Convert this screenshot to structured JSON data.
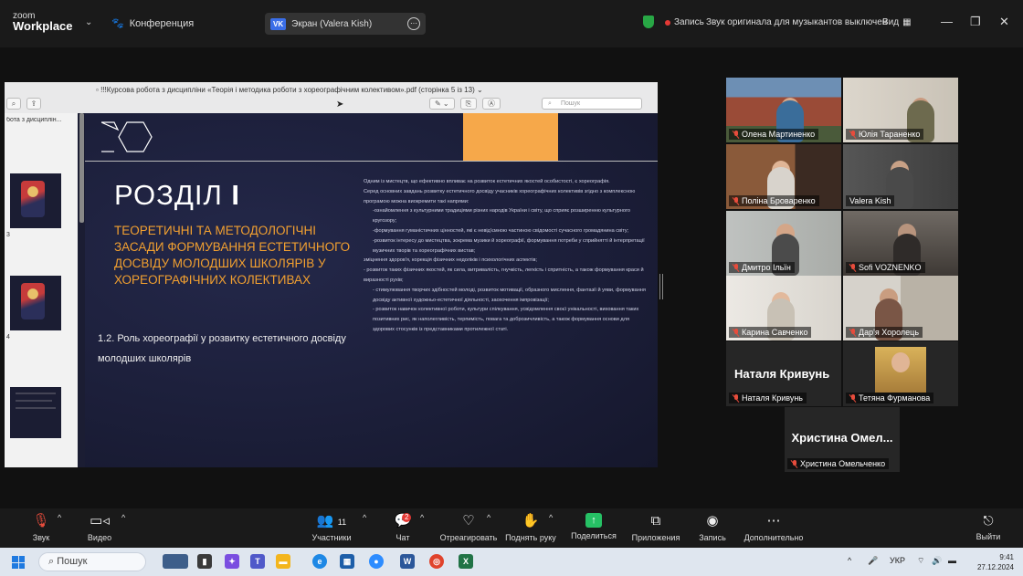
{
  "topbar": {
    "logo_line1": "zoom",
    "logo_line2": "Workplace",
    "conference_label": "Конференция",
    "screen_badge": "VK",
    "screen_label": "Экран (Valera Kish)",
    "recording_label": "Запись",
    "original_sound": "Звук оригинала для музыкантов выключен",
    "view_label": "Вид"
  },
  "pdf": {
    "title": "!!!Курсова робота з дисципліни «Теорія і методика роботи з хореографічним колективом».pdf (сторінка 5 із 13)",
    "search_placeholder": "Пошук",
    "sidebar_label": "бота з дисциплін...",
    "thumb_numbers": [
      "3",
      "4"
    ]
  },
  "slide": {
    "heading": "РОЗДІЛ",
    "heading_numeral": "І",
    "subtitle": "ТЕОРЕТИЧНІ ТА МЕТОДОЛОГІЧНІ ЗАСАДИ ФОРМУВАННЯ ЕСТЕТИЧНОГО ДОСВІДУ МОЛОДШИХ ШКОЛЯРІВ У ХОРЕОГРАФІЧНИХ КОЛЕКТИВАХ",
    "section": "1.2. Роль хореографії у розвитку естетичного досвіду молодших школярів",
    "paragraphs": [
      "Одним із мистецтв, що ефективно впливає на розвиток естетичних якостей особистості, є хореографія.",
      "Серед основних завдань розвитку естетичного досвіду учасників хореографічних колективів згідно з комплексною програмою можна виокремити такі напрями:",
      "-ознайомлення з культурними традиціями різних народів України і світу, що сприяє розширенню культурного кругозору;",
      "-формування гуманістичних цінностей, які є невід'ємною частиною свідомості сучасного громадянина світу;",
      "-розвиток інтересу до мистецтва, зокрема музики й хореографії, формування потреби у сприйнятті й інтерпретації музичних творів та хореографічних вистав;",
      "зміцнення здоров'я, корекція фізичних недоліків і психологічних аспектів;",
      "- розвиток таких фізичних якостей, як сила, витривалість, гнучкість, легкість і спритність, а також формування краси й виразності рухів;",
      "- стимулювання творчих здібностей молоді, розвиток мотивації, образного мислення, фантазії й уяви, формування досвіду активної художньо-естетичної діяльності, заохочення імпровізації;",
      "- розвиток навичок колективної роботи, культури спілкування, усвідомлення своєї унікальності, виховання таких позитивних рис, як наполегливість, терпимість, повага та доброзичливість, а також формування основи для здорових стосунків із представниками протилежної статі."
    ]
  },
  "participants": [
    {
      "name": "Олена Мартиненко",
      "muted": true
    },
    {
      "name": "Юлія Тараненко",
      "muted": true
    },
    {
      "name": "Поліна Броваренко",
      "muted": true
    },
    {
      "name": "Valera Kish",
      "muted": false
    },
    {
      "name": "Дмитро Ільїн",
      "muted": true
    },
    {
      "name": "Sofi VOZNENKO",
      "muted": true
    },
    {
      "name": "Карина Савченко",
      "muted": true
    },
    {
      "name": "Дар'я Хоролець",
      "muted": true
    },
    {
      "name": "Наталя Кривунь",
      "muted": true,
      "big": "Наталя Кривунь"
    },
    {
      "name": "Тетяна Фурманова",
      "muted": true
    },
    {
      "name": "Христина Омельченко",
      "muted": true,
      "big": "Христина Омел..."
    }
  ],
  "toolbar": {
    "audio": "Звук",
    "video": "Видео",
    "participants": "Участники",
    "participants_count": "11",
    "chat": "Чат",
    "chat_badge": "2",
    "react": "Отреагировать",
    "raise_hand": "Поднять руку",
    "share": "Поделиться",
    "apps": "Приложения",
    "record": "Запись",
    "more": "Дополнительно",
    "leave": "Выйти"
  },
  "taskbar": {
    "search": "Пошук",
    "lang": "УКР",
    "time": "9:41",
    "date": "27.12.2024"
  },
  "colors": {
    "accent_green": "#26c165",
    "slide_orange": "#f2a030",
    "record_red": "#e53935"
  }
}
